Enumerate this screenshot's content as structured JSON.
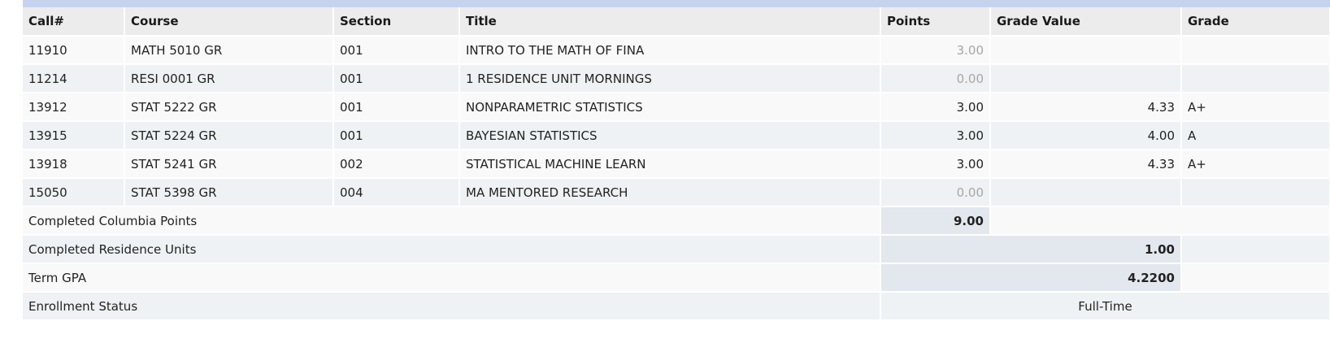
{
  "columns": [
    "Call#",
    "Course",
    "Section",
    "Title",
    "Points",
    "Grade Value",
    "Grade"
  ],
  "courses": [
    {
      "call": "11910",
      "course": "MATH 5010 GR",
      "section": "001",
      "title": "INTRO TO THE MATH OF FINA",
      "points": "3.00",
      "grade_value": "",
      "grade": ""
    },
    {
      "call": "11214",
      "course": "RESI 0001 GR",
      "section": "001",
      "title": "1 RESIDENCE UNIT MORNINGS",
      "points": "0.00",
      "grade_value": "",
      "grade": ""
    },
    {
      "call": "13912",
      "course": "STAT 5222 GR",
      "section": "001",
      "title": "NONPARAMETRIC STATISTICS",
      "points": "3.00",
      "grade_value": "4.33",
      "grade": "A+"
    },
    {
      "call": "13915",
      "course": "STAT 5224 GR",
      "section": "001",
      "title": "BAYESIAN STATISTICS",
      "points": "3.00",
      "grade_value": "4.00",
      "grade": "A"
    },
    {
      "call": "13918",
      "course": "STAT 5241 GR",
      "section": "002",
      "title": "STATISTICAL MACHINE LEARN",
      "points": "3.00",
      "grade_value": "4.33",
      "grade": "A+"
    },
    {
      "call": "15050",
      "course": "STAT 5398 GR",
      "section": "004",
      "title": "MA MENTORED RESEARCH",
      "points": "0.00",
      "grade_value": "",
      "grade": ""
    }
  ],
  "summary": {
    "columbia_points_label": "Completed Columbia Points",
    "columbia_points_value": "9.00",
    "residence_units_label": "Completed Residence Units",
    "residence_units_value": "1.00",
    "term_gpa_label": "Term GPA",
    "term_gpa_value": "4.2200",
    "enrollment_status_label": "Enrollment Status",
    "enrollment_status_value": "Full-Time"
  },
  "colors": {
    "top_band": "#c5d3ee",
    "header_bg": "#ececec",
    "row_odd": "#f9f9f9",
    "row_even": "#eef2f4",
    "summary_value_bg": "#e3e7ee",
    "muted_text": "#a6a6a6"
  }
}
